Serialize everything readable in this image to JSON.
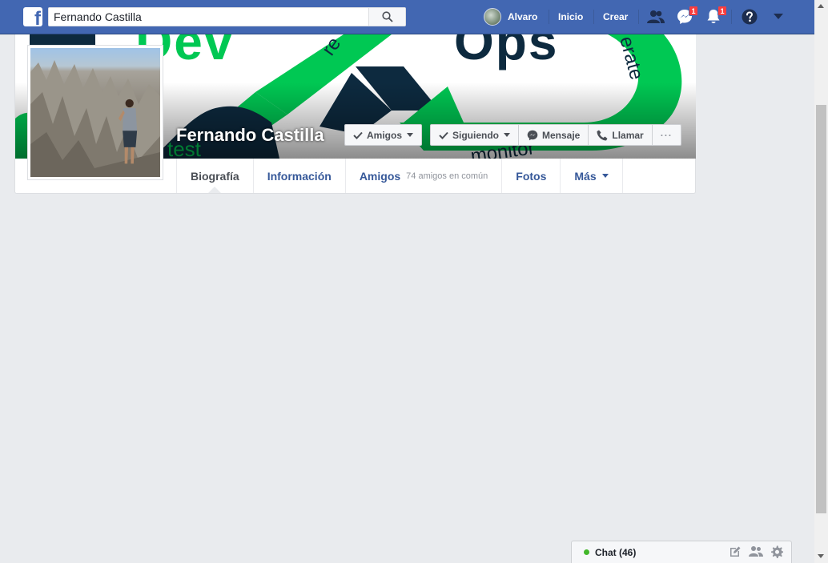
{
  "topbar": {
    "logo_letter": "f",
    "search_value": "Fernando Castilla",
    "user_name": "Alvaro",
    "home_label": "Inicio",
    "create_label": "Crear",
    "messages_badge": "1",
    "notifications_badge": "1"
  },
  "cover": {
    "word_dev": "Dev",
    "word_ops": "Ops",
    "word_test": "test",
    "word_monitor": "monitor",
    "word_release": "re",
    "word_iterate": "erate"
  },
  "profile": {
    "name": "Fernando Castilla",
    "friends_button": "Amigos",
    "following_button": "Siguiendo",
    "message_button": "Mensaje",
    "call_button": "Llamar",
    "more_button": "···"
  },
  "tabs": [
    {
      "label": "Biografía"
    },
    {
      "label": "Información"
    },
    {
      "label": "Amigos",
      "sub": "74 amigos en común"
    },
    {
      "label": "Fotos"
    },
    {
      "label": "Más"
    }
  ],
  "chat": {
    "label": "Chat (46)"
  },
  "colors": {
    "brand": "#4267b2",
    "link": "#365899",
    "badge": "#fa3e3e",
    "online": "#42b72a"
  }
}
